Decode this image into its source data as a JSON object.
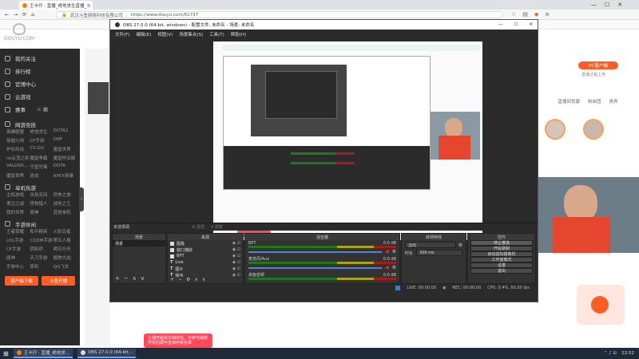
{
  "browser": {
    "tab_title": "王卡仔 · 直播_绝地求生直播_斗",
    "address_site": "武汉斗鱼网络科技有限公司",
    "address_url": "https://www.douyu.com/61737"
  },
  "douyu": {
    "logo_text": "DOUYU.COM",
    "sidebar": {
      "items": [
        {
          "label": "我的关注"
        },
        {
          "label": "排行榜"
        },
        {
          "label": "官博中心"
        },
        {
          "label": "云游戏"
        },
        {
          "label": "赛事"
        }
      ],
      "sections": [
        {
          "title": "网游竞技",
          "cats": [
            "英雄联盟",
            "绝地求生",
            "DOTA2",
            "穿越火线",
            "CF手游",
            "DNF",
            "炉石传说",
            "CS:GO",
            "魔兽世界",
            "lol云顶之弈",
            "魔兽争霸",
            "魔兽怀旧服",
            "VALORA...",
            "守望先锋",
            "DOTA",
            "魔兽世界",
            "逆战",
            "APEX英雄"
          ]
        },
        {
          "title": "单机热游",
          "cats": [
            "主机游戏",
            "永劫无间",
            "恐怖之旅",
            "鬼泣之战",
            "怪物猎人",
            "战地之王",
            "我的世界",
            "原神",
            "其他单机"
          ]
        },
        {
          "title": "手游休闲",
          "cats": [
            "王者荣耀",
            "和平精英",
            "火影忍者",
            "LOL手游",
            "CODM手游",
            "第五人格",
            "CF手游",
            "阴阳师",
            "明日方舟",
            "原神",
            "天刀手游",
            "植物大战",
            "手游中心",
            "掌机",
            "QQ飞车"
          ]
        }
      ],
      "btn_left": "客户端下载",
      "btn_right": "斗鱼开播"
    },
    "right_panel": {
      "pc_client": "PC客户端",
      "upload_hint": "直播过程上传",
      "tabs": [
        "直播间贡献",
        "粉丝团",
        "贵宾"
      ]
    },
    "toast": "主播开始举办抽奖啦，可参与抽奖开奖后即可查询中奖名单"
  },
  "obs": {
    "title": "OBS 27.0.0 (64-bit, windows) - 配置文件: 未命名 - 场景: 未命名",
    "menu": [
      "文件(F)",
      "编辑(E)",
      "视图(V)",
      "场景集合(S)",
      "工具(T)",
      "帮助(H)"
    ],
    "no_source": "未选择源",
    "properties_label": "属性",
    "filters_label": "滤镜",
    "docks": {
      "scenes": "场景",
      "sources": "来源",
      "mixer": "混音器",
      "transitions": "转场特效",
      "controls": "控件"
    },
    "scene_item": "场景",
    "sources": [
      "图像",
      "窗口捕获",
      "BPT",
      "Live",
      "图片",
      "我叫"
    ],
    "mixer": [
      {
        "name": "BPT",
        "db": "0.0 dB"
      },
      {
        "name": "麦克风/Aux",
        "db": "0.0 dB"
      },
      {
        "name": "桌面音频",
        "db": "0.0 dB"
      }
    ],
    "transition": {
      "type": "淡出",
      "duration_label": "时长",
      "duration": "300 ms"
    },
    "controls": [
      "停止推流",
      "开始录制",
      "启动虚拟摄像机",
      "工作室模式",
      "设置",
      "退出"
    ],
    "status": {
      "live": "LIVE: 00:00:00",
      "rec": "REC: 00:00:00",
      "cpu": "CPU: 0.4%, 60.00 fps"
    }
  },
  "taskbar": {
    "items": [
      "王卡仔 · 直播_绝地求...",
      "OBS 27.0.0 (64-bit..."
    ],
    "time": "22:52"
  }
}
